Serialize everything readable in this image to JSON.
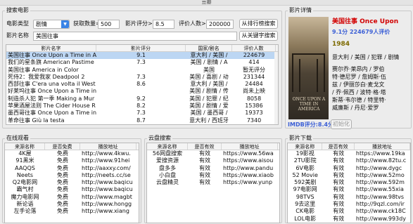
{
  "window": {
    "title": "豆瓣"
  },
  "search": {
    "group_title": "搜索电影",
    "type_label": "电影类型",
    "type_value": "剧情",
    "count_label": "获取数量=",
    "count_value": "500",
    "rating_label": "影片评分>",
    "rating_value": "8.5",
    "voters_label": "评价人数>",
    "voters_value": "200000",
    "rank_button": "从排行榜搜索",
    "name_label": "影片名称",
    "name_value": "美国往事",
    "keyword_button": "从关键字搜索"
  },
  "results": {
    "headers": [
      "影片名字",
      "影片评分",
      "国家/剧名",
      "评价人数"
    ],
    "rows": [
      [
        "美国往事 Once Upon a Time in A",
        "9.1",
        "意大利 / 美国 /",
        "224679"
      ],
      [
        "我们的星条旗 American Pastime",
        "7.3",
        "美国 / 剧情 / A",
        "414"
      ],
      [
        "美国往事 America in Color",
        "",
        "美国",
        "暂无评分"
      ],
      [
        "死侍2：我爱我家 Deadpool 2",
        "7.3",
        "美国 / 喜剧 / 动",
        "231344"
      ],
      [
        "西部往事 C'era una volta il West",
        "8.6",
        "意大利 / 美国 /",
        "24484"
      ],
      [
        "好莱坞往事 Once Upon a Time in",
        "",
        "美国 / 剧情 / 传",
        "尚未上映"
      ],
      [
        "制造杀人犯 第一季 Making a Mur",
        "9.2",
        "美国 / 犯罪 / 纪",
        "8058"
      ],
      [
        "苹果酒屋法则 The Cider House R",
        "8.2",
        "美国 / 剧情 / 爱",
        "15386"
      ],
      [
        "墨西哥往事 Once Upon a Time in",
        "7.3",
        "美国 / 墨西哥 /",
        "19373"
      ],
      [
        "革命往事 Giù la testa",
        "8.7",
        "意大利 / 西班牙",
        "7340"
      ]
    ]
  },
  "details": {
    "group_title": "影片详情",
    "poster_text": "ONCE UPON A TIME IN AMERICA",
    "title": "美国往事 Once Upon",
    "rating_line": "9.1分 224679人评价",
    "year": "1984",
    "genre": "意大利 / 美国 / 犯罪 / 剧情",
    "cast_lines": [
      "赛尔乔·莱昂内 / 罗伯",
      "特·德尼罗 / 詹姆斯·伍",
      "兹 / 伊丽莎白·麦戈文",
      "/ 乔·佩西 / 波特·格·塔",
      "斯蒂·韦尔德 / 特里特·",
      "威廉斯 / 丹尼·爱罗"
    ],
    "imdb": "IMDB评分:8.4分",
    "init_button": "初始化"
  },
  "online": {
    "group_title": "在线观看",
    "headers": [
      "来源名称",
      "是否免费",
      "播放地址"
    ],
    "rows": [
      [
        "4K屋",
        "免费",
        "http://www.4kwu."
      ],
      [
        "91黑米",
        "免费",
        "http://www.91hei"
      ],
      [
        "AAQQS",
        "免费",
        "http://aaxxy.com/"
      ],
      [
        "Neets",
        "免费",
        "http://neets.cc/se"
      ],
      [
        "Q2电影网",
        "免费",
        "http://www.baqicu"
      ],
      [
        "霸气村",
        "免费",
        "http://www.baqicu"
      ],
      [
        "魔力电影网",
        "免费",
        "http://www.magbt"
      ],
      [
        "新论语",
        "免费",
        "http://www.hongg"
      ],
      [
        "左手论落",
        "免费",
        "http://www.xiang"
      ]
    ]
  },
  "cloud": {
    "group_title": "云盘搜索",
    "headers": [
      "来源名称",
      "是否有效",
      "播放地址"
    ],
    "rows": [
      [
        "56网盘搜索",
        "有效",
        "https://www.56wa"
      ],
      [
        "爱搜资源",
        "有效",
        "https://www.aisou"
      ],
      [
        "盘多多",
        "有效",
        "http://www.pandu"
      ],
      [
        "小白盘",
        "有效",
        "https://www.xiaob"
      ],
      [
        "云盘精灵",
        "有效",
        "https://www.yunp"
      ]
    ]
  },
  "download": {
    "group_title": "影片下载",
    "headers": [
      "来源名称",
      "是否有效",
      "播放地址"
    ],
    "rows": [
      [
        "19影视",
        "有效",
        "https://www.19ka"
      ],
      [
        "2TU影院",
        "有效",
        "http://www.82tu.c"
      ],
      [
        "6V电影",
        "有效",
        "http://www.dygc"
      ],
      [
        "52 Movie",
        "有效",
        "http://www.52mo"
      ],
      [
        "592美剧",
        "有效",
        "http://www.592m"
      ],
      [
        "97电影网",
        "有效",
        "http://www.55xia"
      ],
      [
        "98TVS",
        "有效",
        "http://www.98tvs"
      ],
      [
        "9去这里",
        "有效",
        "http://9qzl.com/ir"
      ],
      [
        "CK电影",
        "有效",
        "http://www.ck18C"
      ],
      [
        "LOL电影",
        "有效",
        "http://www.993dy"
      ]
    ]
  }
}
